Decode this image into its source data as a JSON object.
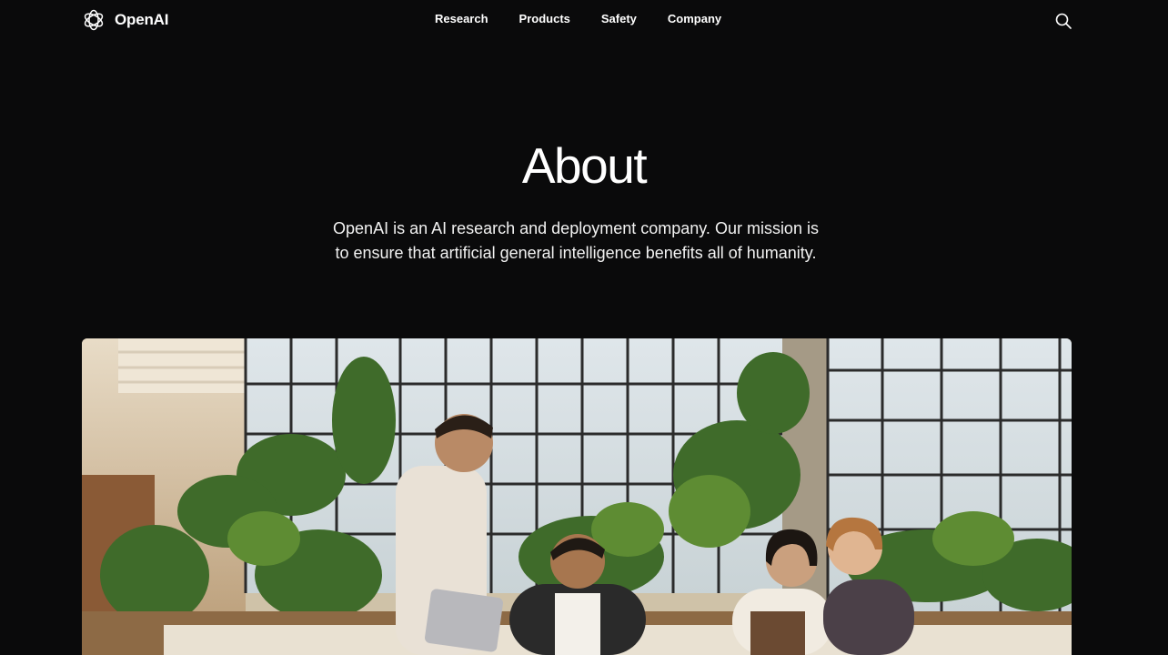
{
  "brand": {
    "name": "OpenAI",
    "logo_icon": "openai-logo-icon"
  },
  "nav": {
    "items": [
      {
        "label": "Research"
      },
      {
        "label": "Products"
      },
      {
        "label": "Safety"
      },
      {
        "label": "Company"
      }
    ],
    "search_icon": "search-icon"
  },
  "hero": {
    "title": "About",
    "description_line1": "OpenAI is an AI research and deployment company. Our mission is",
    "description_line2": "to ensure that artificial general intelligence benefits all of humanity."
  },
  "photo": {
    "subject": "team-photo"
  },
  "colors": {
    "background": "#0a0a0b",
    "text": "#ffffff"
  }
}
